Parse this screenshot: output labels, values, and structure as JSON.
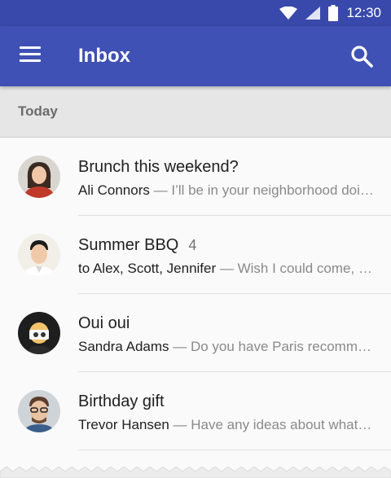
{
  "status_bar": {
    "time": "12:30"
  },
  "app_bar": {
    "title": "Inbox"
  },
  "section": {
    "label": "Today"
  },
  "messages": [
    {
      "subject": "Brunch this weekend?",
      "count": "",
      "sender": "Ali Connors",
      "separator": " — ",
      "snippet": "I’ll be in your neighborhood doing errands this weekend."
    },
    {
      "subject": "Summer BBQ",
      "count": "4",
      "sender": "to Alex, Scott, Jennifer",
      "separator": " — ",
      "snippet": "Wish I could come, but I’m out of town this weekend."
    },
    {
      "subject": "Oui oui",
      "count": "",
      "sender": "Sandra Adams",
      "separator": " — ",
      "snippet": "Do you have Paris recommendations? Have you ever been?"
    },
    {
      "subject": "Birthday gift",
      "count": "",
      "sender": "Trevor Hansen",
      "separator": " — ",
      "snippet": "Have any ideas about what we should get Heidi for her birthday?"
    }
  ],
  "colors": {
    "status_bar": "#3949ab",
    "app_bar": "#3f51b5",
    "background": "#fafafa",
    "section_header": "#e6e6e6"
  },
  "icons": [
    "wifi-icon",
    "signal-icon",
    "battery-icon",
    "menu-icon",
    "search-icon"
  ]
}
